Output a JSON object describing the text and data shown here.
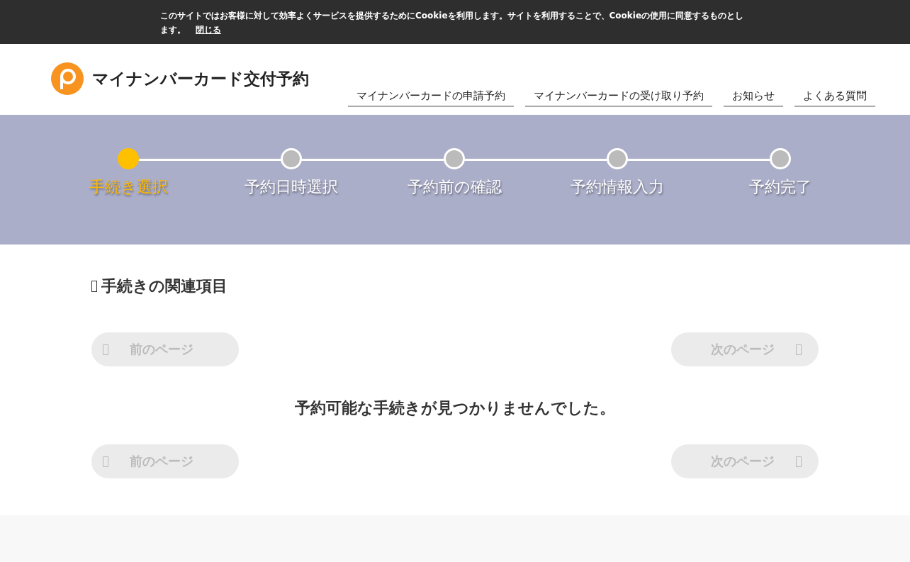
{
  "cookie_banner": {
    "message": "このサイトではお客様に対して効率よくサービスを提供するためにCookieを利用します。サイトを利用することで、Cookieの使用に同意するものとします。",
    "close_link": "閉じる"
  },
  "header": {
    "site_title": "マイナンバーカード交付予約",
    "nav": [
      "マイナンバーカードの申請予約",
      "マイナンバーカードの受け取り予約",
      "お知らせ",
      "よくある質問"
    ]
  },
  "steps": [
    {
      "label": "手続き選択",
      "selected": true
    },
    {
      "label": "予約日時選択",
      "selected": false
    },
    {
      "label": "予約前の確認",
      "selected": false
    },
    {
      "label": "予約情報入力",
      "selected": false
    },
    {
      "label": "予約完了",
      "selected": false
    }
  ],
  "section_heading": "手続きの関連項目",
  "pager_top": {
    "prev": {
      "label": "前のページ",
      "disabled": true
    },
    "next": {
      "label": "次のページ",
      "disabled": true
    }
  },
  "empty_message": "予約可能な手続きが見つかりませんでした。",
  "pager_bottom": {
    "prev": {
      "label": "前のページ",
      "disabled": true
    },
    "next": {
      "label": "次のページ",
      "disabled": true
    }
  }
}
